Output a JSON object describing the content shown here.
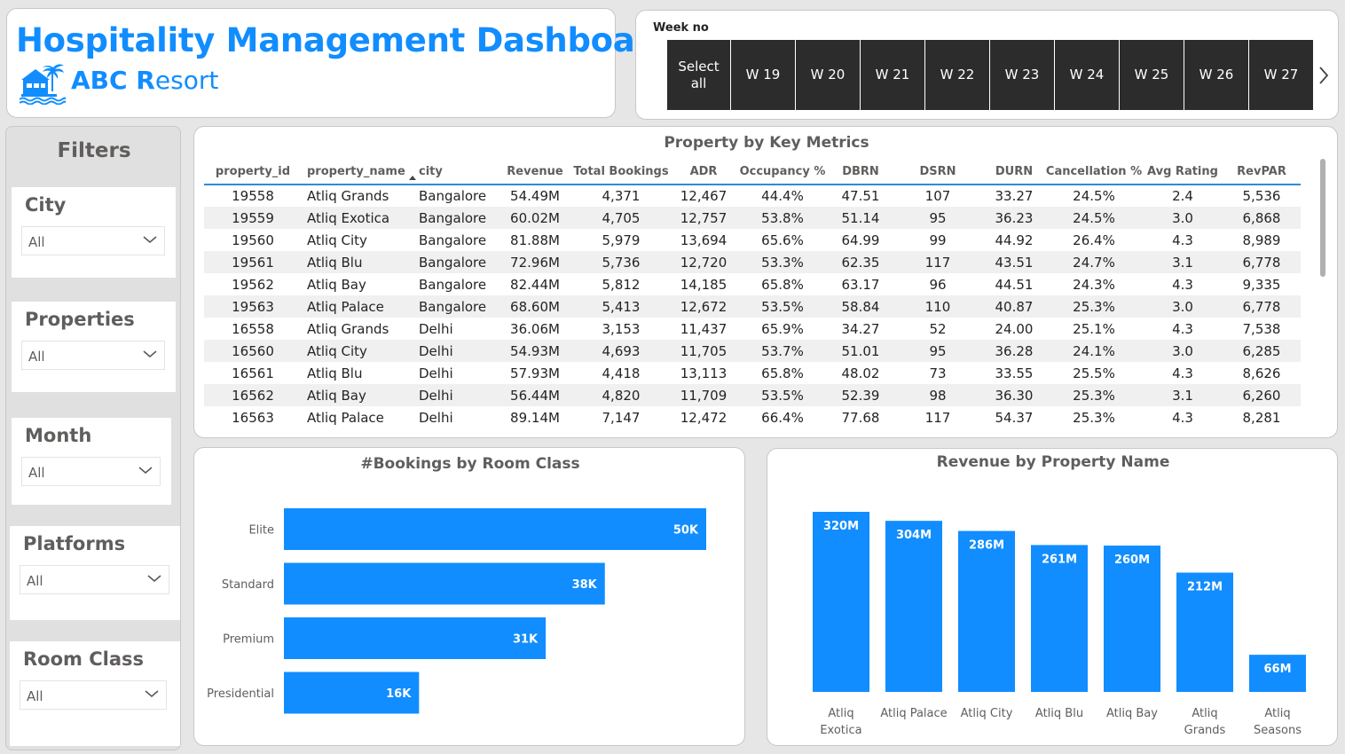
{
  "header": {
    "title": "Hospitality Management Dashboard",
    "resort_prefix": "ABC R",
    "resort_suffix": "esort"
  },
  "week_slicer": {
    "label": "Week no",
    "tiles": [
      "Select all",
      "W 19",
      "W 20",
      "W 21",
      "W 22",
      "W 23",
      "W 24",
      "W 25",
      "W 26",
      "W 27"
    ]
  },
  "filters": {
    "title": "Filters",
    "items": [
      {
        "label": "City",
        "value": "All"
      },
      {
        "label": "Properties",
        "value": "All"
      },
      {
        "label": "Month",
        "value": "All"
      },
      {
        "label": "Platforms",
        "value": "All"
      },
      {
        "label": "Room Class",
        "value": "All"
      }
    ]
  },
  "table": {
    "title": "Property by Key Metrics",
    "columns": [
      "property_id",
      "property_name",
      "city",
      "Revenue",
      "Total Bookings",
      "ADR",
      "Occupancy %",
      "DBRN",
      "DSRN",
      "DURN",
      "Cancellation %",
      "Avg Rating",
      "RevPAR"
    ],
    "rows": [
      [
        "19558",
        "Atliq Grands",
        "Bangalore",
        "54.49M",
        "4,371",
        "12,467",
        "44.4%",
        "47.51",
        "107",
        "33.27",
        "24.5%",
        "2.4",
        "5,536"
      ],
      [
        "19559",
        "Atliq Exotica",
        "Bangalore",
        "60.02M",
        "4,705",
        "12,757",
        "53.8%",
        "51.14",
        "95",
        "36.23",
        "24.5%",
        "3.0",
        "6,868"
      ],
      [
        "19560",
        "Atliq City",
        "Bangalore",
        "81.88M",
        "5,979",
        "13,694",
        "65.6%",
        "64.99",
        "99",
        "44.92",
        "26.4%",
        "4.3",
        "8,989"
      ],
      [
        "19561",
        "Atliq Blu",
        "Bangalore",
        "72.96M",
        "5,736",
        "12,720",
        "53.3%",
        "62.35",
        "117",
        "43.51",
        "24.7%",
        "3.1",
        "6,778"
      ],
      [
        "19562",
        "Atliq Bay",
        "Bangalore",
        "82.44M",
        "5,812",
        "14,185",
        "65.8%",
        "63.17",
        "96",
        "44.51",
        "24.3%",
        "4.3",
        "9,335"
      ],
      [
        "19563",
        "Atliq Palace",
        "Bangalore",
        "68.60M",
        "5,413",
        "12,672",
        "53.5%",
        "58.84",
        "110",
        "40.87",
        "25.3%",
        "3.0",
        "6,778"
      ],
      [
        "16558",
        "Atliq Grands",
        "Delhi",
        "36.06M",
        "3,153",
        "11,437",
        "65.9%",
        "34.27",
        "52",
        "24.00",
        "25.1%",
        "4.3",
        "7,538"
      ],
      [
        "16560",
        "Atliq City",
        "Delhi",
        "54.93M",
        "4,693",
        "11,705",
        "53.7%",
        "51.01",
        "95",
        "36.28",
        "24.1%",
        "3.0",
        "6,285"
      ],
      [
        "16561",
        "Atliq Blu",
        "Delhi",
        "57.93M",
        "4,418",
        "13,113",
        "65.8%",
        "48.02",
        "73",
        "33.55",
        "25.5%",
        "4.3",
        "8,626"
      ],
      [
        "16562",
        "Atliq Bay",
        "Delhi",
        "56.44M",
        "4,820",
        "11,709",
        "53.5%",
        "52.39",
        "98",
        "36.30",
        "25.3%",
        "3.1",
        "6,260"
      ],
      [
        "16563",
        "Atliq Palace",
        "Delhi",
        "89.14M",
        "7,147",
        "12,472",
        "66.4%",
        "77.68",
        "117",
        "54.37",
        "25.3%",
        "4.3",
        "8,281"
      ]
    ]
  },
  "colors": {
    "accent": "#118dff",
    "tile_bg": "#2c2c2c"
  },
  "chart_data": [
    {
      "type": "bar",
      "orientation": "horizontal",
      "title": "#Bookings by Room Class",
      "categories": [
        "Elite",
        "Standard",
        "Premium",
        "Presidential"
      ],
      "values": [
        50,
        38,
        31,
        16
      ],
      "value_labels": [
        "50K",
        "38K",
        "31K",
        "16K"
      ],
      "unit": "K",
      "xlim": [
        0,
        50
      ],
      "color": "#118dff"
    },
    {
      "type": "bar",
      "orientation": "vertical",
      "title": "Revenue by Property Name",
      "categories": [
        "Atliq Exotica",
        "Atliq Palace",
        "Atliq City",
        "Atliq Blu",
        "Atliq Bay",
        "Atliq Grands",
        "Atliq Seasons"
      ],
      "category_lines": [
        [
          "Atliq",
          "Exotica"
        ],
        [
          "Atliq Palace"
        ],
        [
          "Atliq City"
        ],
        [
          "Atliq Blu"
        ],
        [
          "Atliq Bay"
        ],
        [
          "Atliq",
          "Grands"
        ],
        [
          "Atliq",
          "Seasons"
        ]
      ],
      "values": [
        320,
        304,
        286,
        261,
        260,
        212,
        66
      ],
      "value_labels": [
        "320M",
        "304M",
        "286M",
        "261M",
        "260M",
        "212M",
        "66M"
      ],
      "unit": "M",
      "ylim": [
        0,
        320
      ],
      "color": "#118dff"
    }
  ]
}
